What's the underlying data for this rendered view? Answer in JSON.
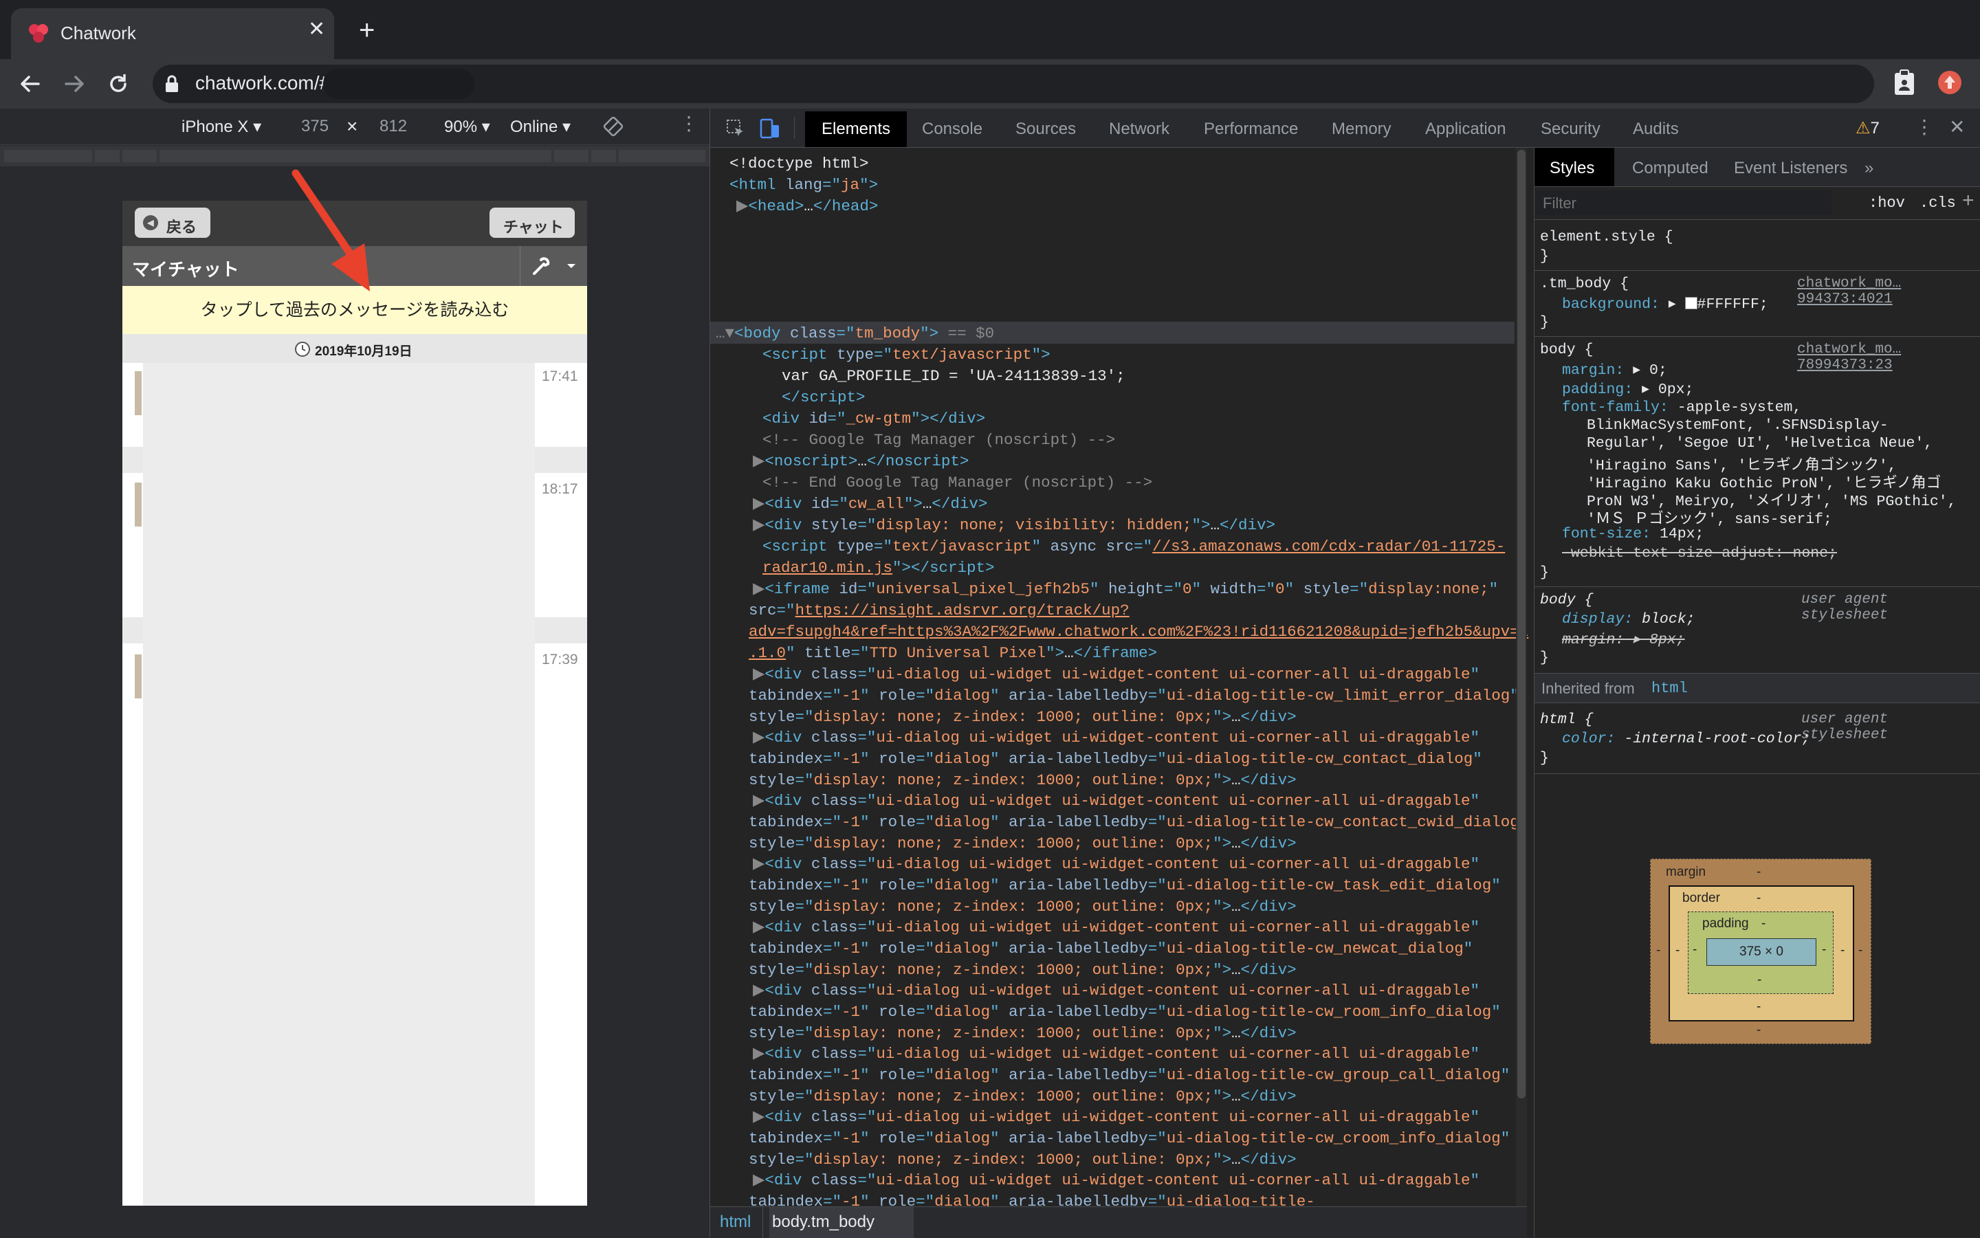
{
  "browser": {
    "tab_title": "Chatwork",
    "tab_close": "✕",
    "new_tab": "+",
    "url": "chatwork.com/#",
    "warnings_count": "7"
  },
  "device_toolbar": {
    "device": "iPhone X",
    "width": "375",
    "times": "×",
    "height": "812",
    "zoom": "90%",
    "network": "Online"
  },
  "phone": {
    "back_label": "戻る",
    "chat_label": "チャット",
    "room_title": "マイチャット",
    "load_older": "タップして過去のメッセージを読み込む",
    "date": "2019年10月19日",
    "times": [
      "17:41",
      "18:17",
      "17:39"
    ]
  },
  "devtools": {
    "tabs": [
      "Elements",
      "Console",
      "Sources",
      "Network",
      "Performance",
      "Memory",
      "Application",
      "Security",
      "Audits"
    ],
    "breadcrumbs": [
      "html",
      "body.tm_body"
    ],
    "styles_tabs": [
      "Styles",
      "Computed",
      "Event Listeners",
      "»"
    ],
    "filter_placeholder": "Filter",
    "hov": ":hov",
    "cls": ".cls",
    "add": "+",
    "rules": {
      "element_style": "element.style {",
      "tm_body_sel": ".tm_body {",
      "tm_body_src": "chatwork_mo…994373:4021",
      "tm_body_bg": "background:",
      "tm_body_bg_val": "#FFFFFF;",
      "body_sel": "body {",
      "body_src": "chatwork_mo…78994373:23",
      "body_margin": "margin:",
      "body_margin_val": "0;",
      "body_padding": "padding:",
      "body_padding_val": "0px;",
      "body_font_family": "font-family:",
      "body_font_family_val1": "-apple-system,",
      "body_font_family_val2": "BlinkMacSystemFont, '.SFNSDisplay-",
      "body_font_family_val3": "Regular', 'Segoe UI', 'Helvetica Neue',",
      "body_font_family_val4": "'Hiragino Sans', 'ヒラギノ角ゴシック',",
      "body_font_family_val5": "'Hiragino Kaku Gothic ProN', 'ヒラギノ角ゴ",
      "body_font_family_val6": "ProN W3', Meiryo, 'メイリオ', 'MS PGothic',",
      "body_font_family_val7": "'ＭＳ Ｐゴシック', sans-serif;",
      "body_font_size": "font-size:",
      "body_font_size_val": "14px;",
      "body_webkit": "-webkit-text-size-adjust: none;",
      "ua_body_sel": "body {",
      "ua_label": "user agent stylesheet",
      "ua_display": "display:",
      "ua_display_val": "block;",
      "ua_margin": "margin:",
      "ua_margin_val": "8px;",
      "inherited_label": "Inherited from",
      "inherited_tag": "html",
      "html_sel": "html {",
      "html_color": "color:",
      "html_color_val": "-internal-root-color;",
      "close_brace": "}"
    },
    "box_model": {
      "margin_label": "margin",
      "border_label": "border",
      "padding_label": "padding",
      "content": "375 × 0",
      "dash": "-"
    }
  },
  "colors": {
    "background_swatch": "#FFFFFF",
    "annotation_arrow": "#e8412c"
  }
}
